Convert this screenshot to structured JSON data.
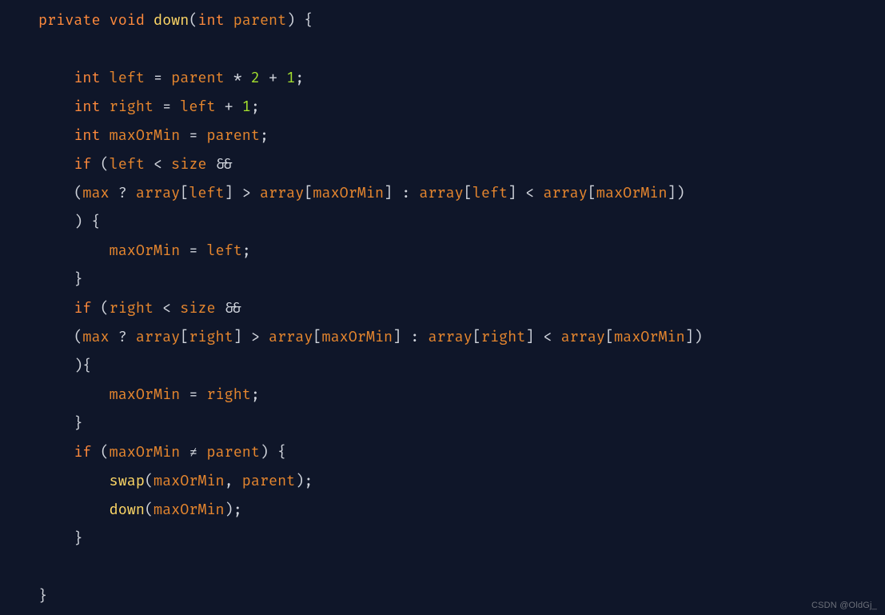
{
  "tokens": {
    "kw_private": "private",
    "kw_void": "void",
    "kw_int": "int",
    "kw_if": "if",
    "fn_down": "down",
    "fn_swap": "swap",
    "id_parent": "parent",
    "id_left": "left",
    "id_right": "right",
    "id_maxOrMin": "maxOrMin",
    "id_size": "size",
    "id_max": "max",
    "id_array": "array",
    "num_2": "2",
    "num_1": "1",
    "op_eq": "=",
    "op_star": "*",
    "op_plus": "+",
    "op_semi": ";",
    "op_lt": "<",
    "op_gt": ">",
    "op_ne": "≠",
    "op_and": "&&",
    "op_q": "?",
    "op_colon": ":",
    "op_comma": ",",
    "p_lparen": "(",
    "p_rparen": ")",
    "p_lbrace": "{",
    "p_rbrace": "}",
    "p_lbrack": "[",
    "p_rbrack": "]"
  },
  "watermark": "CSDN @OldGj_"
}
